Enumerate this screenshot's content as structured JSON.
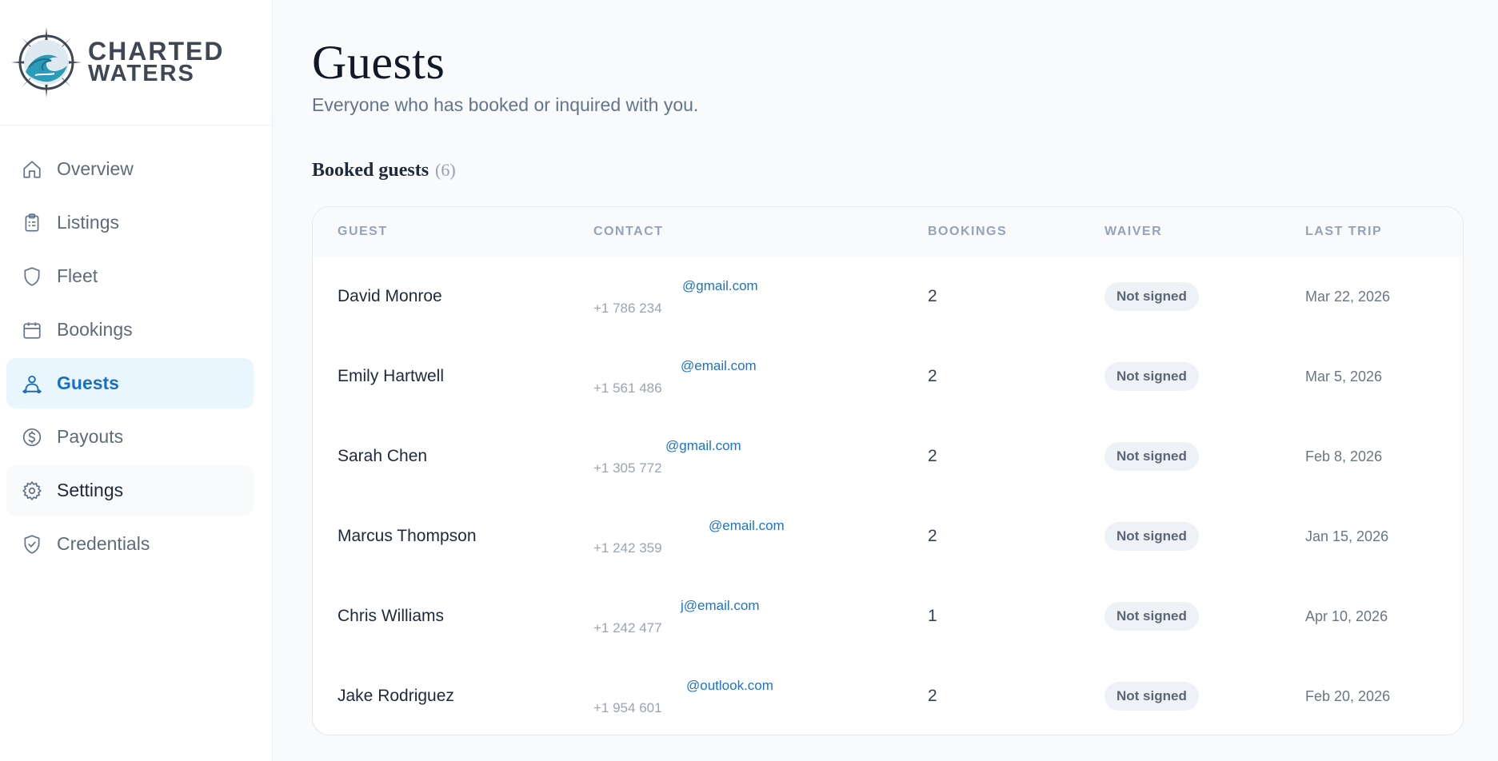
{
  "brand": {
    "line1": "CHARTED",
    "line2": "WATERS"
  },
  "nav": [
    {
      "label": "Overview",
      "icon": "home-icon"
    },
    {
      "label": "Listings",
      "icon": "clipboard-icon"
    },
    {
      "label": "Fleet",
      "icon": "shield-icon"
    },
    {
      "label": "Bookings",
      "icon": "calendar-icon"
    },
    {
      "label": "Guests",
      "icon": "guests-icon",
      "active": true
    },
    {
      "label": "Payouts",
      "icon": "dollar-circle-icon"
    },
    {
      "label": "Settings",
      "icon": "gear-icon",
      "hovered": true
    },
    {
      "label": "Credentials",
      "icon": "shield-check-icon"
    }
  ],
  "page": {
    "title": "Guests",
    "subtitle": "Everyone who has booked or inquired with you."
  },
  "section": {
    "title": "Booked guests",
    "count": "(6)"
  },
  "table": {
    "headers": [
      "GUEST",
      "CONTACT",
      "BOOKINGS",
      "WAIVER",
      "LAST TRIP"
    ],
    "rows": [
      {
        "name": "David Monroe",
        "email": "@gmail.com",
        "phone": "+1 786 234",
        "bookings": "2",
        "waiver": "Not signed",
        "last_trip": "Mar 22, 2026"
      },
      {
        "name": "Emily Hartwell",
        "email": "@email.com",
        "phone": "+1 561 486",
        "bookings": "2",
        "waiver": "Not signed",
        "last_trip": "Mar 5, 2026"
      },
      {
        "name": "Sarah Chen",
        "email": "@gmail.com",
        "phone": "+1 305 772",
        "bookings": "2",
        "waiver": "Not signed",
        "last_trip": "Feb 8, 2026"
      },
      {
        "name": "Marcus Thompson",
        "email": "@email.com",
        "phone": "+1 242 359",
        "bookings": "2",
        "waiver": "Not signed",
        "last_trip": "Jan 15, 2026"
      },
      {
        "name": "Chris Williams",
        "email": "j@email.com",
        "phone": "+1 242 477",
        "bookings": "1",
        "waiver": "Not signed",
        "last_trip": "Apr 10, 2026"
      },
      {
        "name": "Jake Rodriguez",
        "email": "@outlook.com",
        "phone": "+1 954 601",
        "bookings": "2",
        "waiver": "Not signed",
        "last_trip": "Feb 20, 2026"
      }
    ]
  }
}
